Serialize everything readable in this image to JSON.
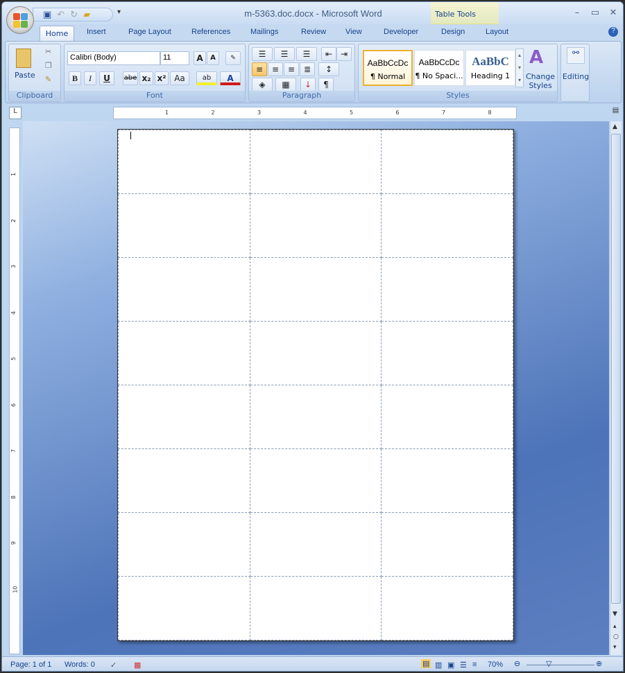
{
  "window": {
    "title": "m-5363.doc.docx - Microsoft Word",
    "contextual_tab_group": "Table Tools"
  },
  "tabs": [
    "Home",
    "Insert",
    "Page Layout",
    "References",
    "Mailings",
    "Review",
    "View",
    "Developer",
    "Design",
    "Layout"
  ],
  "active_tab": "Home",
  "ribbon": {
    "clipboard": {
      "label": "Clipboard",
      "paste": "Paste"
    },
    "font": {
      "label": "Font",
      "font_name": "Calibri (Body)",
      "font_size": "11",
      "bold": "B",
      "italic": "I",
      "underline": "U",
      "strike": "abe",
      "subscript": "x₂",
      "superscript": "x²",
      "change_case": "Aa",
      "grow": "A",
      "shrink": "A",
      "font_color": "A",
      "highlight": "ab"
    },
    "paragraph": {
      "label": "Paragraph",
      "pilcrow": "¶"
    },
    "styles": {
      "label": "Styles",
      "items": [
        {
          "preview": "AaBbCcDc",
          "name": "¶ Normal"
        },
        {
          "preview": "AaBbCcDc",
          "name": "¶ No Spaci..."
        },
        {
          "preview": "AaBbC",
          "name": "Heading 1"
        }
      ],
      "change_styles": "Change Styles"
    },
    "editing": {
      "label": "Editing"
    }
  },
  "ruler": {
    "numbers": [
      "1",
      "2",
      "3",
      "4",
      "5",
      "6",
      "7",
      "8"
    ],
    "vertical_numbers": [
      "1",
      "2",
      "3",
      "4",
      "5",
      "6",
      "7",
      "8",
      "9",
      "10"
    ]
  },
  "document": {
    "table_rows": 8,
    "table_cols": 3
  },
  "status": {
    "page": "Page: 1 of 1",
    "words": "Words: 0",
    "zoom": "70%"
  },
  "colors": {
    "accent": "#15428b",
    "ribbon": "#c4d8f0",
    "doc_bg": "#5c7fc0"
  }
}
